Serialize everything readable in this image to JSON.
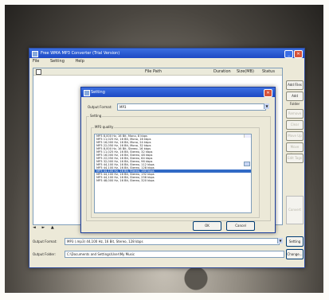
{
  "main_window": {
    "title": "Free WMA MP3 Converter (Trial Version)",
    "menu": [
      "File",
      "Setting",
      "Help"
    ],
    "columns": [
      "File Path",
      "Duration",
      "Size(MB)",
      "Status"
    ],
    "side_buttons": [
      {
        "label": "Add Files",
        "enabled": true
      },
      {
        "label": "Add Folder",
        "enabled": true
      },
      {
        "label": "Remove",
        "enabled": false
      },
      {
        "label": "Clear",
        "enabled": false
      },
      {
        "label": "Move Up",
        "enabled": false
      },
      {
        "label": "Move Down",
        "enabled": false
      },
      {
        "label": "Edit Tags",
        "enabled": false
      }
    ],
    "convert_label": "Convert",
    "nav_glyphs": [
      "◄",
      "►",
      "▲"
    ],
    "output_format_label": "Output Format:",
    "output_format_value": "MP3 (.mp3) 44,100 Hz, 16 Bit, Stereo, 128 kbps",
    "output_folder_label": "Output Folder:",
    "output_folder_value": "C:\\Documents and Settings\\User\\My Music",
    "setting_button": "Setting",
    "browse_button": "Change..."
  },
  "dialog": {
    "title": "Setting",
    "output_format_label": "Output Format:",
    "output_format_value": "MP3",
    "group_label": "Setting",
    "inner_label": "MP3 quality",
    "options": [
      "MP3 8,000 Hz, 16 Bit, Mono, 8 kbps",
      "MP3 11,025 Hz, 16 Bit, Mono, 16 kbps",
      "MP3 16,000 Hz, 16 Bit, Mono, 24 kbps",
      "MP3 22,050 Hz, 16 Bit, Mono, 32 kbps",
      "MP3 8,000 Hz, 16 Bit, Stereo, 16 kbps",
      "MP3 11,025 Hz, 16 Bit, Stereo, 32 kbps",
      "MP3 16,000 Hz, 16 Bit, Stereo, 48 kbps",
      "MP3 22,050 Hz, 16 Bit, Stereo, 64 kbps",
      "MP3 32,000 Hz, 16 Bit, Stereo, 96 kbps",
      "MP3 44,100 Hz, 16 Bit, Stereo, 112 kbps",
      "MP3 44,100 Hz, 16 Bit, Stereo, 128 kbps",
      "MP3 44,100 Hz, 16 Bit, Stereo, 160 kbps",
      "MP3 44,100 Hz, 16 Bit, Stereo, 192 kbps",
      "MP3 44,100 Hz, 16 Bit, Stereo, 256 kbps",
      "MP3 48,000 Hz, 16 Bit, Stereo, 320 kbps"
    ],
    "selected_index": 11,
    "ok_label": "OK",
    "cancel_label": "Cancel",
    "close_glyph": "✕"
  }
}
